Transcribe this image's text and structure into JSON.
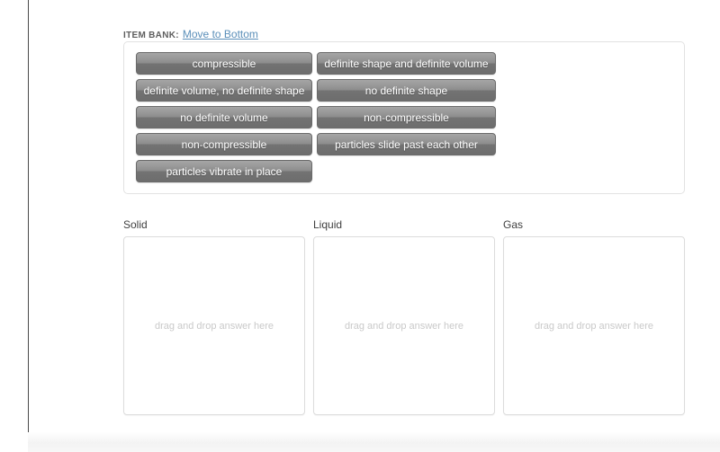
{
  "page": {
    "cut_off_heading": "",
    "background_color": "#ffffff"
  },
  "item_bank": {
    "label": "ITEM BANK:",
    "move_link": "Move to Bottom",
    "link_color": "#5b8fb9",
    "tile_rows": [
      {
        "left": "compressible",
        "right": "definite shape and definite volume"
      },
      {
        "left": "definite volume, no definite shape",
        "right": "no definite shape"
      },
      {
        "left": "no definite volume",
        "right": "non-compressible"
      },
      {
        "left": "non-compressible",
        "right": "particles slide past each other"
      },
      {
        "left": "particles vibrate in place",
        "right": ""
      }
    ]
  },
  "drop_zones": [
    {
      "label": "Solid",
      "placeholder": "drag and drop answer here"
    },
    {
      "label": "Liquid",
      "placeholder": "drag and drop answer here"
    },
    {
      "label": "Gas",
      "placeholder": "drag and drop answer here"
    }
  ]
}
